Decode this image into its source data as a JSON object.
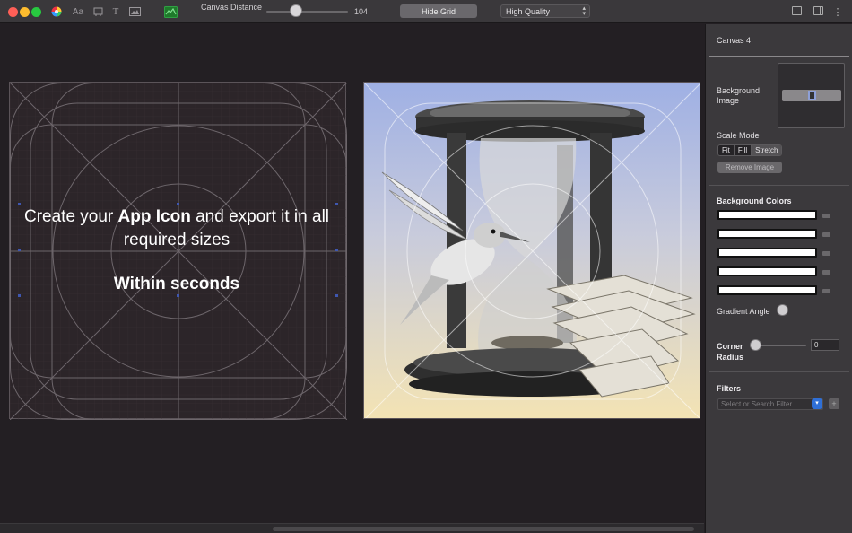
{
  "toolbar": {
    "canvas_distance_label": "Canvas Distance",
    "canvas_distance_value": "104",
    "canvas_distance_level": 0.35,
    "font_icon_text": "Aa",
    "text_icon_text": "T",
    "hide_grid_label": "Hide Grid",
    "quality_value": "High Quality"
  },
  "canvas": {
    "headline_part1": "Create your ",
    "headline_bold": "App Icon",
    "headline_part2": " and export it in all required sizes",
    "tagline": "Within seconds"
  },
  "panel": {
    "canvas_name": "Canvas 4",
    "background_image_label": "Background Image",
    "scale_mode_label": "Scale Mode",
    "scale_modes": [
      "Fit",
      "Fill",
      "Stretch"
    ],
    "scale_mode_selected": "Stretch",
    "remove_image_label": "Remove Image",
    "background_colors_label": "Background Colors",
    "gradient_angle_label": "Gradient Angle",
    "corner_radius_label": "Corner Radius",
    "corner_radius_value": "0",
    "filters_label": "Filters",
    "filter_placeholder": "Select or Search Filter"
  },
  "colors": {
    "window_bg": "#231f23",
    "panel_bg": "#3b393c",
    "accent_blue": "#2f6fd6",
    "traffic_red": "#ff5f57",
    "traffic_yellow": "#febc2e",
    "traffic_green": "#28c840"
  }
}
